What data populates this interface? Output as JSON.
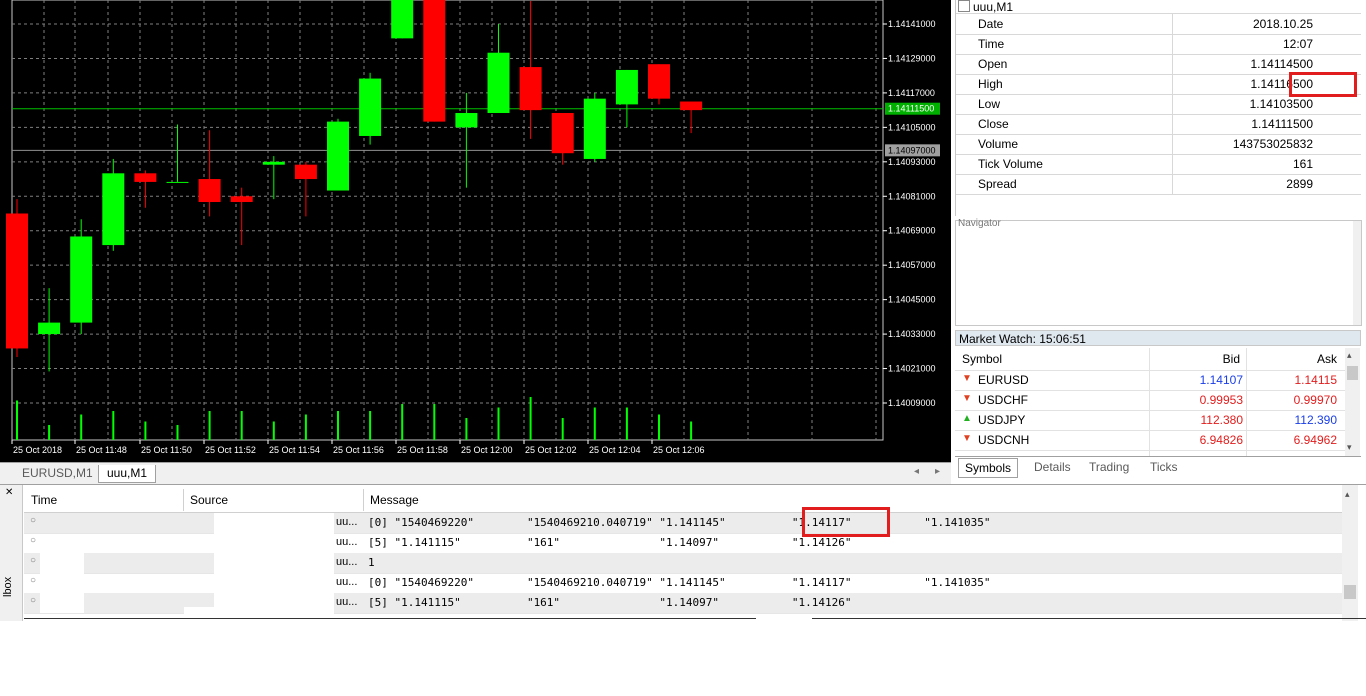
{
  "chart": {
    "price_labels": [
      "1.14141000",
      "1.14129000",
      "1.14117000",
      "1.14105000",
      "1.14093000",
      "1.14081000",
      "1.14069000",
      "1.14057000",
      "1.14045000",
      "1.14033000",
      "1.14021000",
      "1.14009000"
    ],
    "bid_price_label": "1.14111500",
    "ask_price_label": "1.14097000",
    "time_labels": [
      "25 Oct 2018",
      "25 Oct 11:48",
      "25 Oct 11:50",
      "25 Oct 11:52",
      "25 Oct 11:54",
      "25 Oct 11:56",
      "25 Oct 11:58",
      "25 Oct 12:00",
      "25 Oct 12:02",
      "25 Oct 12:04",
      "25 Oct 12:06"
    ],
    "colors": {
      "bull": "#00ff00",
      "bear": "#ff0000",
      "grid": "#7f7f7f",
      "bid_line": "#00c000",
      "ask_line": "#909090",
      "bid_tag": "#00b000",
      "ask_tag": "#a0a0a0"
    },
    "tabs": [
      "EURUSD,M1",
      "uuu,M1"
    ],
    "active_tab": "uuu,M1"
  },
  "chart_data": {
    "type": "candlestick",
    "bid_line": 1.141115,
    "ask_line": 1.14097,
    "candles": [
      {
        "open": 1.14075,
        "close": 1.14028,
        "high": 1.1408,
        "low": 1.14025,
        "volume": 0.9
      },
      {
        "open": 1.14033,
        "close": 1.14037,
        "high": 1.14049,
        "low": 1.1402,
        "volume": 0.2
      },
      {
        "open": 1.14037,
        "close": 1.14067,
        "high": 1.14073,
        "low": 1.14033,
        "volume": 0.5
      },
      {
        "open": 1.14064,
        "close": 1.14089,
        "high": 1.14094,
        "low": 1.14062,
        "volume": 0.6
      },
      {
        "open": 1.14089,
        "close": 1.14086,
        "high": 1.1409,
        "low": 1.14077,
        "volume": 0.3
      },
      {
        "open": 1.14086,
        "close": 1.14086,
        "high": 1.14106,
        "low": 1.14086,
        "volume": 0.2
      },
      {
        "open": 1.14087,
        "close": 1.14079,
        "high": 1.14104,
        "low": 1.14074,
        "volume": 0.6
      },
      {
        "open": 1.14081,
        "close": 1.14079,
        "high": 1.14084,
        "low": 1.14064,
        "volume": 0.6
      },
      {
        "open": 1.14092,
        "close": 1.14093,
        "high": 1.14095,
        "low": 1.1408,
        "volume": 0.3
      },
      {
        "open": 1.14092,
        "close": 1.14087,
        "high": 1.14093,
        "low": 1.14074,
        "volume": 0.5
      },
      {
        "open": 1.14083,
        "close": 1.14107,
        "high": 1.14108,
        "low": 1.14083,
        "volume": 0.6
      },
      {
        "open": 1.14102,
        "close": 1.14122,
        "high": 1.14124,
        "low": 1.14099,
        "volume": 0.6
      },
      {
        "open": 1.14136,
        "close": 1.1415,
        "high": 1.1415,
        "low": 1.14136,
        "volume": 0.8
      },
      {
        "open": 1.14172,
        "close": 1.14107,
        "high": 1.14172,
        "low": 1.14107,
        "volume": 0.8
      },
      {
        "open": 1.14105,
        "close": 1.1411,
        "high": 1.14117,
        "low": 1.14084,
        "volume": 0.4
      },
      {
        "open": 1.1411,
        "close": 1.14131,
        "high": 1.14141,
        "low": 1.1411,
        "volume": 0.7
      },
      {
        "open": 1.14126,
        "close": 1.14111,
        "high": 1.14149,
        "low": 1.14101,
        "volume": 1.0
      },
      {
        "open": 1.1411,
        "close": 1.14096,
        "high": 1.1411,
        "low": 1.14092,
        "volume": 0.4
      },
      {
        "open": 1.14094,
        "close": 1.14115,
        "high": 1.14117,
        "low": 1.14093,
        "volume": 0.7
      },
      {
        "open": 1.14113,
        "close": 1.14125,
        "high": 1.14125,
        "low": 1.14105,
        "volume": 0.7
      },
      {
        "open": 1.14127,
        "close": 1.14115,
        "high": 1.14127,
        "low": 1.14113,
        "volume": 0.5
      },
      {
        "open": 1.14114,
        "close": 1.14111,
        "high": 1.14114,
        "low": 1.14103,
        "volume": 0.3
      }
    ]
  },
  "data_window": {
    "title": "uuu,M1",
    "rows": [
      {
        "label": "Date",
        "value": "2018.10.25"
      },
      {
        "label": "Time",
        "value": "12:07"
      },
      {
        "label": "Open",
        "value": "1.14114500"
      },
      {
        "label": "High",
        "value": "1.14116500"
      },
      {
        "label": "Low",
        "value": "1.14103500"
      },
      {
        "label": "Close",
        "value": "1.14111500"
      },
      {
        "label": "Volume",
        "value": "143753025832"
      },
      {
        "label": "Tick Volume",
        "value": "161"
      },
      {
        "label": "Spread",
        "value": "2899"
      }
    ]
  },
  "navigator": {
    "title": "Navigator"
  },
  "market_watch": {
    "title": "Market Watch: 15:06:51",
    "headers": {
      "symbol": "Symbol",
      "bid": "Bid",
      "ask": "Ask"
    },
    "rows": [
      {
        "symbol": "EURUSD",
        "bid": "1.14107",
        "ask": "1.14115",
        "bid_color": "#1a3ee8",
        "ask_color": "#e21d1d",
        "arrow": "down"
      },
      {
        "symbol": "USDCHF",
        "bid": "0.99953",
        "ask": "0.99970",
        "bid_color": "#e21d1d",
        "ask_color": "#e21d1d",
        "arrow": "down"
      },
      {
        "symbol": "USDJPY",
        "bid": "112.380",
        "ask": "112.390",
        "bid_color": "#e21d1d",
        "ask_color": "#1a3ee8",
        "arrow": "up"
      },
      {
        "symbol": "USDCNH",
        "bid": "6.94826",
        "ask": "6.94962",
        "bid_color": "#e21d1d",
        "ask_color": "#e21d1d",
        "arrow": "down"
      }
    ],
    "tabs": [
      "Symbols",
      "Details",
      "Trading",
      "Ticks"
    ],
    "active_tab": "Symbols"
  },
  "terminal": {
    "headers": {
      "time": "Time",
      "source": "Source",
      "message": "Message"
    },
    "side_label": "lbox",
    "rows": [
      {
        "source": "uu...",
        "message": "[0] \"1540469220\"        \"1540469210.040719\" \"1.141145\"          \"1.14117\"           \"1.141035\""
      },
      {
        "source": "uu...",
        "message": "[5] \"1.141115\"          \"161\"               \"1.14097\"           \"1.14126\""
      },
      {
        "source": "uu...",
        "message": "1"
      },
      {
        "source": "uu...",
        "message": "[0] \"1540469220\"        \"1540469210.040719\" \"1.141145\"          \"1.14117\"           \"1.141035\""
      },
      {
        "source": "uu...",
        "message": "[5] \"1.141115\"          \"161\"               \"1.14097\"           \"1.14126\""
      }
    ]
  }
}
